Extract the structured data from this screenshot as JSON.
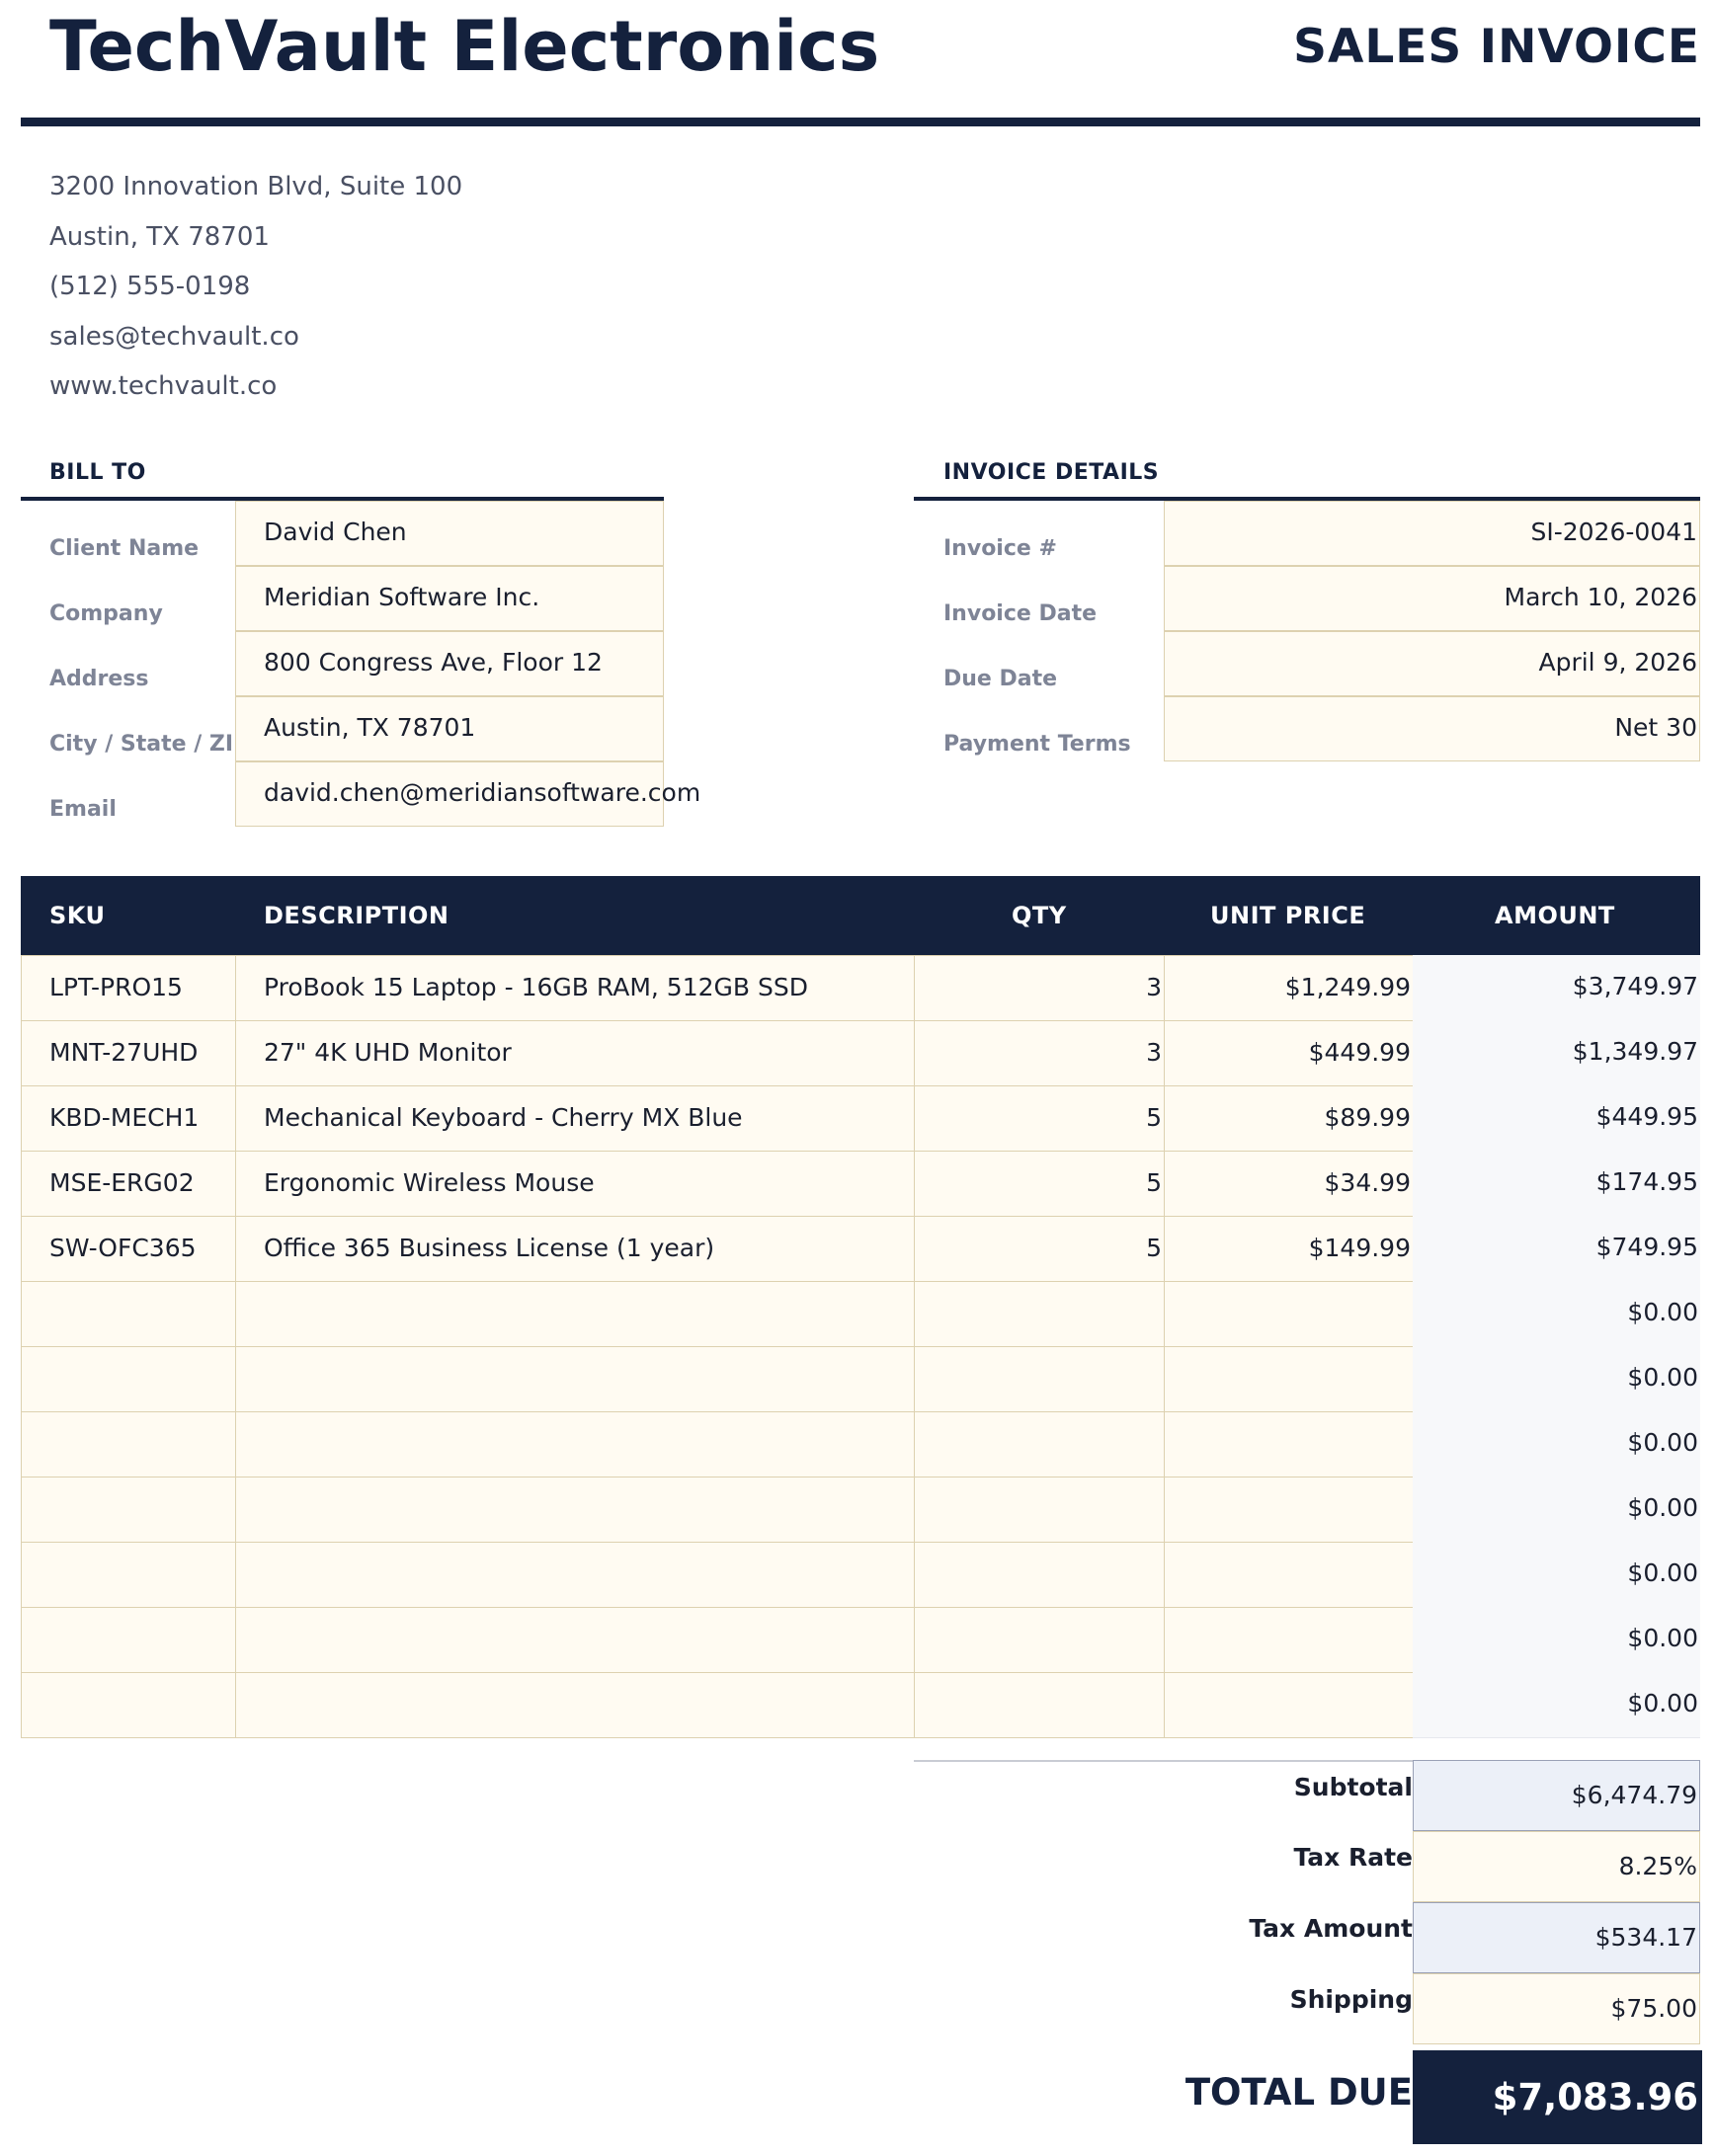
{
  "company": {
    "name": "TechVault Electronics",
    "address_lines": [
      "3200 Innovation Blvd, Suite 100",
      "Austin, TX 78701",
      "(512) 555-0198",
      "sales@techvault.co",
      "www.techvault.co"
    ]
  },
  "document_title": "SALES INVOICE",
  "bill_to": {
    "title": "BILL TO",
    "fields": [
      {
        "label": "Client Name",
        "value": "David Chen"
      },
      {
        "label": "Company",
        "value": "Meridian Software Inc."
      },
      {
        "label": "Address",
        "value": "800 Congress Ave, Floor 12"
      },
      {
        "label": "City / State / ZIP",
        "value": "Austin, TX 78701"
      },
      {
        "label": "Email",
        "value": "david.chen@meridiansoftware.com"
      }
    ]
  },
  "invoice_details": {
    "title": "INVOICE DETAILS",
    "fields": [
      {
        "label": "Invoice #",
        "value": "SI-2026-0041"
      },
      {
        "label": "Invoice Date",
        "value": "March 10, 2026"
      },
      {
        "label": "Due Date",
        "value": "April 9, 2026"
      },
      {
        "label": "Payment Terms",
        "value": "Net 30"
      }
    ]
  },
  "items_table": {
    "headers": {
      "sku": "SKU",
      "description": "DESCRIPTION",
      "qty": "QTY",
      "unit_price": "UNIT PRICE",
      "amount": "AMOUNT"
    },
    "rows": [
      {
        "sku": "LPT-PRO15",
        "description": "ProBook 15 Laptop - 16GB RAM, 512GB SSD",
        "qty": "3",
        "unit_price": "$1,249.99",
        "amount": "$3,749.97"
      },
      {
        "sku": "MNT-27UHD",
        "description": "27\" 4K UHD Monitor",
        "qty": "3",
        "unit_price": "$449.99",
        "amount": "$1,349.97"
      },
      {
        "sku": "KBD-MECH1",
        "description": "Mechanical Keyboard - Cherry MX Blue",
        "qty": "5",
        "unit_price": "$89.99",
        "amount": "$449.95"
      },
      {
        "sku": "MSE-ERG02",
        "description": "Ergonomic Wireless Mouse",
        "qty": "5",
        "unit_price": "$34.99",
        "amount": "$174.95"
      },
      {
        "sku": "SW-OFC365",
        "description": "Office 365 Business License (1 year)",
        "qty": "5",
        "unit_price": "$149.99",
        "amount": "$749.95"
      },
      {
        "sku": "",
        "description": "",
        "qty": "",
        "unit_price": "",
        "amount": "$0.00"
      },
      {
        "sku": "",
        "description": "",
        "qty": "",
        "unit_price": "",
        "amount": "$0.00"
      },
      {
        "sku": "",
        "description": "",
        "qty": "",
        "unit_price": "",
        "amount": "$0.00"
      },
      {
        "sku": "",
        "description": "",
        "qty": "",
        "unit_price": "",
        "amount": "$0.00"
      },
      {
        "sku": "",
        "description": "",
        "qty": "",
        "unit_price": "",
        "amount": "$0.00"
      },
      {
        "sku": "",
        "description": "",
        "qty": "",
        "unit_price": "",
        "amount": "$0.00"
      },
      {
        "sku": "",
        "description": "",
        "qty": "",
        "unit_price": "",
        "amount": "$0.00"
      }
    ]
  },
  "totals": {
    "subtotal_label": "Subtotal",
    "subtotal": "$6,474.79",
    "tax_rate_label": "Tax Rate",
    "tax_rate": "8.25%",
    "tax_amount_label": "Tax Amount",
    "tax_amount": "$534.17",
    "shipping_label": "Shipping",
    "shipping": "$75.00",
    "total_label": "TOTAL DUE",
    "total": "$7,083.96"
  },
  "colors": {
    "navy": "#14213d",
    "input_cell": "#fffbf2",
    "calc_cell": "#ecf0f8"
  }
}
